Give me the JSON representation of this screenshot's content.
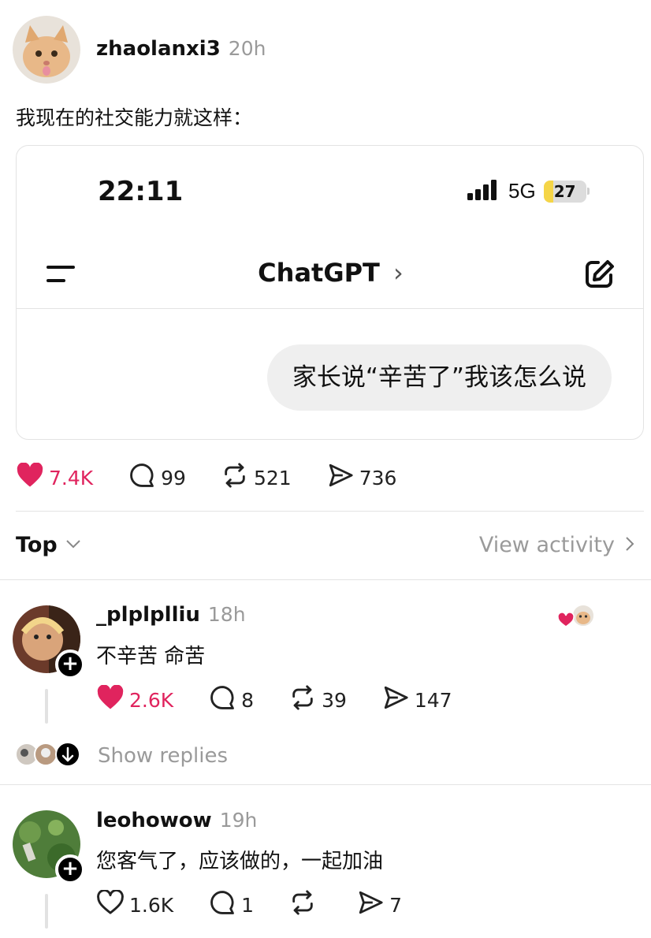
{
  "post": {
    "username": "zhaolanxi3",
    "time": "20h",
    "text": "我现在的社交能力就这样：",
    "likes": "7.4K",
    "comments": "99",
    "reposts": "521",
    "shares": "736"
  },
  "embedded_screenshot": {
    "clock": "22:11",
    "network": "5G",
    "battery": "27",
    "app_title": "ChatGPT",
    "message": "家长说“辛苦了”我该怎么说"
  },
  "replies_header": {
    "sort_label": "Top",
    "view_activity": "View activity"
  },
  "replies": [
    {
      "username": "_plplplliu",
      "time": "18h",
      "text": "不辛苦 命苦",
      "likes": "2.6K",
      "comments": "8",
      "reposts": "39",
      "shares": "147",
      "show_replies": "Show replies"
    },
    {
      "username": "leohowow",
      "time": "19h",
      "text": "您客气了，应该做的，一起加油",
      "likes": "1.6K",
      "comments": "1",
      "reposts": "",
      "shares": "7"
    }
  ],
  "colors": {
    "like_red": "#e0245e",
    "battery_yellow": "#f5d547",
    "muted_grey": "#9a9a9a"
  }
}
